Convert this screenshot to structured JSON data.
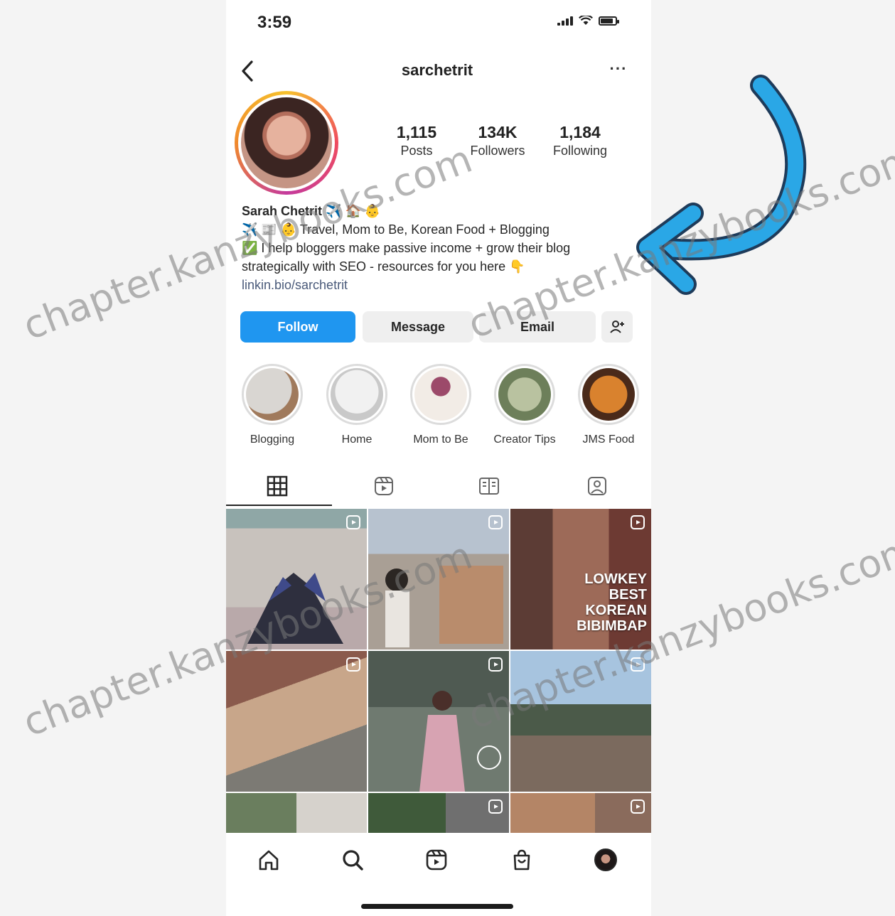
{
  "status_bar": {
    "time": "3:59"
  },
  "header": {
    "username": "sarchetrit",
    "more_label": "···"
  },
  "stats": [
    {
      "value": "1,115",
      "label": "Posts"
    },
    {
      "value": "134K",
      "label": "Followers"
    },
    {
      "value": "1,184",
      "label": "Following"
    }
  ],
  "bio": {
    "name": "Sarah Chetrit",
    "name_emoji": "✈️ 🏠 👶",
    "line1": "✈️ 📰 👶 Travel, Mom to Be, Korean Food + Blogging",
    "line2": "✅ I help bloggers make passive income + grow their blog",
    "line3": "strategically with SEO - resources for you here 👇",
    "link": "linkin.bio/sarchetrit"
  },
  "actions": {
    "follow": "Follow",
    "message": "Message",
    "email": "Email"
  },
  "highlights": [
    {
      "label": "Blogging",
      "color_a": "#d9d6d2",
      "color_b": "#a07a5c"
    },
    {
      "label": "Home",
      "color_a": "#f1f1f1",
      "color_b": "#c9c9c9"
    },
    {
      "label": "Mom to Be",
      "color_a": "#f2ece6",
      "color_b": "#9c4a6a"
    },
    {
      "label": "Creator Tips",
      "color_a": "#b9c2a0",
      "color_b": "#6d7f5a"
    },
    {
      "label": "JMS Food",
      "color_a": "#d9822e",
      "color_b": "#4a2a1a"
    }
  ],
  "posts": [
    {
      "caption": "",
      "reel": true
    },
    {
      "caption": "",
      "reel": true
    },
    {
      "caption": "LOWKEY BEST KOREAN BIBIMBAP",
      "reel": true
    },
    {
      "caption": "",
      "reel": true
    },
    {
      "caption": "",
      "reel": true
    },
    {
      "caption": "",
      "reel": true
    },
    {
      "caption": "",
      "reel": false
    },
    {
      "caption": "",
      "reel": true
    },
    {
      "caption": "",
      "reel": true
    }
  ],
  "watermark": "chapter.kanzybooks.com",
  "colors": {
    "follow_button": "#1f96f0",
    "arrow": "#2aa7e6",
    "text": "#262626"
  }
}
